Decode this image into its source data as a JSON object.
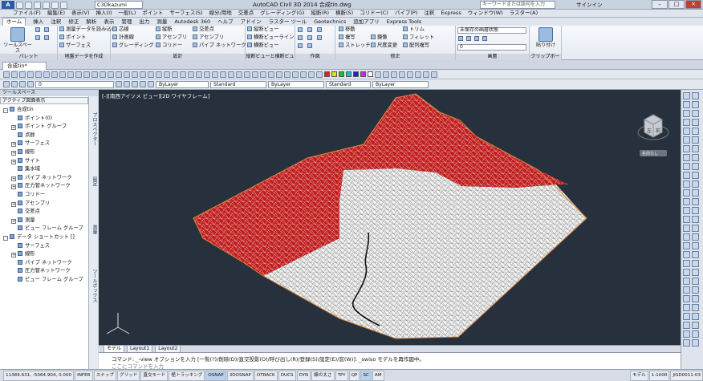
{
  "window": {
    "title": "AutoCAD Civil 3D 2014   合成tin.dwg",
    "user": "C3Dkazumi",
    "search_placeholder": "キーワードまたは語句を入力",
    "signin": "サインイン"
  },
  "menubar": [
    "ファイル(F)",
    "編集(E)",
    "表示(V)",
    "挿入(I)",
    "一般(L)",
    "ポイント",
    "サーフェス(S)",
    "線分/用地",
    "交差点",
    "グレーディング(G)",
    "縦断(R)",
    "横断(S)",
    "コリドー(C)",
    "パイプ(P)",
    "注釈",
    "Express",
    "ウィンドウ(W)",
    "ラスター(A)"
  ],
  "tabs": [
    "ホーム",
    "挿入",
    "注釈",
    "修正",
    "解析",
    "表示",
    "管理",
    "出力",
    "測量",
    "Autodesk 360",
    "ヘルプ",
    "アドイン",
    "ラスター ツール",
    "Geotechnics",
    "追加アプリ",
    "Express Tools"
  ],
  "active_tab": "ホーム",
  "ribbon": {
    "toolspace_label": "ツールスペース",
    "panels": {
      "palettes": "パレット",
      "ground_data": "地盤データを作成",
      "design": "設計",
      "profile_view": "縦断ビューと横断ビュー",
      "draw": "作図",
      "modify": "修正",
      "layers": "画層",
      "clipboard": "クリップボード"
    },
    "ground_items": [
      "測量データを読み込む",
      "ポイント",
      "サーフェス"
    ],
    "design_items": [
      "芯線",
      "縦断",
      "交差点",
      "計画線",
      "アセンブリ",
      "アセンブリ",
      "グレーディング",
      "コリドー",
      "パイプ ネットワーク"
    ],
    "profile_items": [
      "縦断ビュー",
      "横断ビューライン",
      "横断ビュー"
    ],
    "modify_items": [
      "移動",
      "複写",
      "ストレッチ",
      "トリム",
      "フィレット",
      "尺度変更",
      "鏡像",
      "配列複写"
    ],
    "layer_state": "未保存の画層状態",
    "layer_current": "0",
    "paste_label": "貼り付け"
  },
  "document": {
    "tab": "合成tin*"
  },
  "props": {
    "layer": "0",
    "color": "ByLayer",
    "linetype": "ByLayer",
    "lineweight": "ByLayer",
    "text_style": "Standard",
    "dim_style": "Standard"
  },
  "colors": {
    "viewport_bg": "#27313d",
    "tin_red": "#c21c1c",
    "tin_white": "#f2f2f2",
    "accent": "#2a5aa8"
  },
  "toolspace": {
    "header": "ツールスペース",
    "view": "アクティブ図面表示",
    "items": [
      {
        "label": "合成tin",
        "level": 0,
        "exp": "-"
      },
      {
        "label": "ポイント(0)",
        "level": 1,
        "exp": ""
      },
      {
        "label": "ポイント グループ",
        "level": 1,
        "exp": "+"
      },
      {
        "label": "点群",
        "level": 1,
        "exp": ""
      },
      {
        "label": "サーフェス",
        "level": 1,
        "exp": "+"
      },
      {
        "label": "線形",
        "level": 1,
        "exp": "+"
      },
      {
        "label": "サイト",
        "level": 1,
        "exp": "+"
      },
      {
        "label": "集水域",
        "level": 1,
        "exp": ""
      },
      {
        "label": "パイプ ネットワーク",
        "level": 1,
        "exp": "+"
      },
      {
        "label": "圧力管ネットワーク",
        "level": 1,
        "exp": "+"
      },
      {
        "label": "コリドー",
        "level": 1,
        "exp": ""
      },
      {
        "label": "アセンブリ",
        "level": 1,
        "exp": "+"
      },
      {
        "label": "交差点",
        "level": 1,
        "exp": ""
      },
      {
        "label": "測量",
        "level": 1,
        "exp": "+"
      },
      {
        "label": "ビュー フレーム グループ",
        "level": 1,
        "exp": ""
      },
      {
        "label": "データ ショートカット []",
        "level": 0,
        "exp": "-"
      },
      {
        "label": "サーフェス",
        "level": 1,
        "exp": ""
      },
      {
        "label": "線形",
        "level": 1,
        "exp": "+"
      },
      {
        "label": "パイプ ネットワーク",
        "level": 1,
        "exp": ""
      },
      {
        "label": "圧力管ネットワーク",
        "level": 1,
        "exp": ""
      },
      {
        "label": "ビュー フレーム グループ",
        "level": 1,
        "exp": ""
      }
    ],
    "side_tabs": [
      "プロスペクター",
      "設定",
      "測量",
      "ツールボックス"
    ]
  },
  "viewport": {
    "label": "[-][南西アイソメ ビュー][2D ワイヤフレーム]",
    "viewcube_face": "左",
    "viewcube_front": "前",
    "wcs": "名前なし"
  },
  "layout_tabs": [
    "モデル",
    "Layout1",
    "Layout2"
  ],
  "command": {
    "history": "コマンド:  _-view オプションを入力 [一覧(?)/削除(D)/直交投影(O)/呼び出し(R)/登録(S)/設定(E)/窓(W)]: _swiso モデルを再作図中。",
    "prompt": "ここにコマンドを入力"
  },
  "status": {
    "coords": "11389.631, -5064.904, 0.000",
    "toggles": [
      "INFER",
      "スナップ",
      "グリッド",
      "直交モード",
      "極トラッキング",
      "OSNAP",
      "3DOSNAP",
      "OTRACK",
      "DUCS",
      "DYN",
      "線の太さ",
      "TPY",
      "QP",
      "SC",
      "AM"
    ],
    "model_label": "モデル",
    "scale": "1:1000",
    "jis": "JISD0011-03"
  }
}
